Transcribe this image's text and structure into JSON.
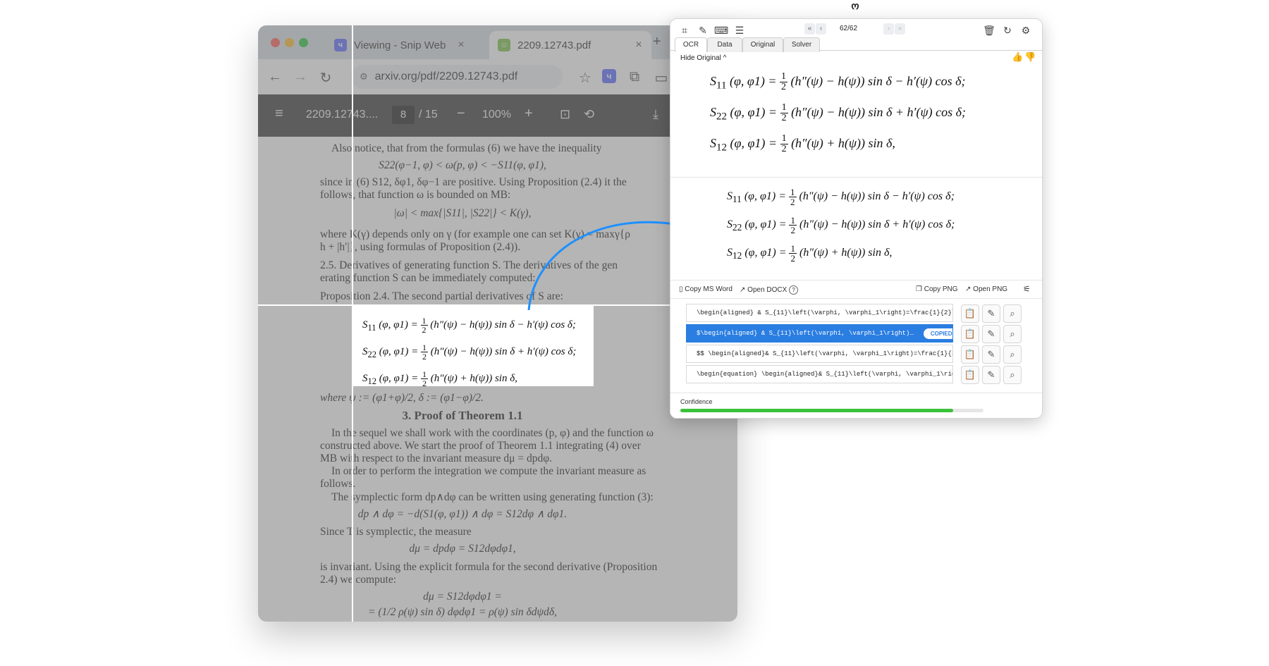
{
  "browser": {
    "tabs": [
      {
        "label": "Viewing - Snip Web",
        "icon": "snip-icon",
        "close": "×"
      },
      {
        "label": "2209.12743.pdf",
        "icon": "pdf-tab-icon",
        "close": "×"
      }
    ],
    "new_tab": "+",
    "url": "arxiv.org/pdf/2209.12743.pdf"
  },
  "pdf_toolbar": {
    "file": "2209.12743....",
    "page": "8",
    "page_total": "/ 15",
    "zoom": "100%",
    "minus": "−",
    "plus": "+"
  },
  "document": {
    "lines": [
      "Also notice, that from the formulas (6) we have the inequality",
      "S22(φ−1, φ) < ω(p, φ) < −S11(φ, φ1),",
      "since in (6) S12, δφ1, δφ−1 are positive.  Using Proposition (2.4) it the",
      "follows, that function ω is bounded on MB:",
      "|ω| < max{|S11|, |S22|} < K(γ),",
      "where K(γ) depends only on γ (for example one can set K(γ) = maxγ{ρ",
      "h + |h′|}, using formulas of Proposition (2.4)).",
      "2.5. Derivatives of generating function S. The derivatives of the gen",
      "erating function S can be immediately computed:",
      "Proposition 2.4. The second partial derivatives of S are:",
      "where ψ := (φ1+φ)/2,    δ := (φ1−φ)/2.",
      "3.  Proof of Theorem 1.1",
      "In the sequel we shall work with the coordinates (p, φ) and the function ω",
      "constructed above. We start the proof of Theorem 1.1 integrating (4) over",
      "MB with respect to the invariant measure dμ = dpdφ.",
      "In order to perform the integration we compute the invariant measure as",
      "follows.",
      "The symplectic form dp∧dφ can be written using generating function (3):",
      "dp ∧ dφ = −d(S1(φ, φ1)) ∧ dφ = S12dφ ∧ dφ1.",
      "Since T is symplectic, the measure",
      "dμ = dpdφ = S12dφdφ1,",
      "is invariant.  Using the explicit formula for the second derivative (Proposition",
      "2.4) we compute:",
      "dμ = S12dφdφ1 =",
      "= (1/2 ρ(ψ) sin δ) dφdφ1 = ρ(ψ) sin δdψdδ,"
    ]
  },
  "equations": [
    {
      "lhs": "S",
      "sub": "11",
      "args": "(φ, φ1) =",
      "frac_n": "1",
      "frac_d": "2",
      "rhs": "(h″(ψ) − h(ψ)) sin δ − h′(ψ) cos δ;"
    },
    {
      "lhs": "S",
      "sub": "22",
      "args": "(φ, φ1) =",
      "frac_n": "1",
      "frac_d": "2",
      "rhs": "(h″(ψ) − h(ψ)) sin δ + h′(ψ) cos δ;"
    },
    {
      "lhs": "S",
      "sub": "12",
      "args": "(φ, φ1) =",
      "frac_n": "1",
      "frac_d": "2",
      "rhs": "(h″(ψ) + h(ψ)) sin δ,"
    }
  ],
  "snip": {
    "counter": "62/62",
    "tabs": [
      "OCR",
      "Data",
      "Original",
      "Solver"
    ],
    "hide_original": "Hide Original ^",
    "copy_ms_word": "Copy MS Word",
    "open_docx": "Open DOCX",
    "copy_png": "Copy PNG",
    "open_png": "Open PNG",
    "results": [
      "\\begin{aligned} & S_{11}\\left(\\varphi, \\varphi_1\\right)=\\frac{1}{2}\\l…",
      "$\\begin{aligned} & S_{11}\\left(\\varphi, \\varphi_1\\right)…",
      "$$ \\begin{aligned}& S_{11}\\left(\\varphi, \\varphi_1\\right)=\\frac{1}{2…",
      "\\begin{equation} \\begin{aligned}& S_{11}\\left(\\varphi, \\varphi_1\\rig…"
    ],
    "copied_badge": "COPIED",
    "confidence_label": "Confidence",
    "confidence": 0.9,
    "accent": "#2a7de1",
    "confidence_color": "#3cc13b"
  }
}
